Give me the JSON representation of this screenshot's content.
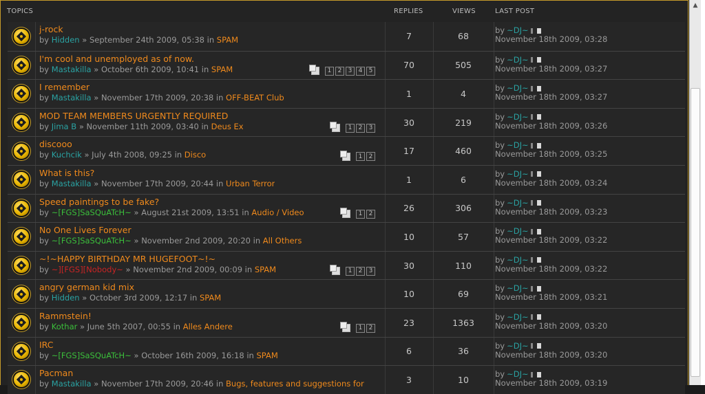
{
  "headers": {
    "topics": "TOPICS",
    "replies": "REPLIES",
    "views": "VIEWS",
    "last_post": "LAST POST"
  },
  "by_word": "by",
  "in_word": "in",
  "sep": "»",
  "topics": [
    {
      "title": "j-rock",
      "author": "Hidden",
      "author_color": "blue",
      "date": "September 24th 2009, 05:38",
      "forum": "SPAM",
      "pages": [],
      "replies": "7",
      "views": "68",
      "last_user": "~DJ~",
      "last_date": "November 18th 2009, 03:28"
    },
    {
      "title": "I'm cool and unemployed as of now.",
      "author": "Mastakilla",
      "author_color": "blue",
      "date": "October 6th 2009, 10:41",
      "forum": "SPAM",
      "pages": [
        "1",
        "2",
        "3",
        "4",
        "5"
      ],
      "replies": "70",
      "views": "505",
      "last_user": "~DJ~",
      "last_date": "November 18th 2009, 03:27"
    },
    {
      "title": "I remember",
      "author": "Mastakilla",
      "author_color": "blue",
      "date": "November 17th 2009, 20:38",
      "forum": "OFF-BEAT Club",
      "pages": [],
      "replies": "1",
      "views": "4",
      "last_user": "~DJ~",
      "last_date": "November 18th 2009, 03:27"
    },
    {
      "title": "MOD TEAM MEMBERS URGENTLY REQUIRED",
      "author": "Jima B",
      "author_color": "blue",
      "date": "November 11th 2009, 03:40",
      "forum": "Deus Ex",
      "pages": [
        "1",
        "2",
        "3"
      ],
      "replies": "30",
      "views": "219",
      "last_user": "~DJ~",
      "last_date": "November 18th 2009, 03:26"
    },
    {
      "title": "discooo",
      "author": "Kuchcik",
      "author_color": "blue",
      "date": "July 4th 2008, 09:25",
      "forum": "Disco",
      "pages": [
        "1",
        "2"
      ],
      "replies": "17",
      "views": "460",
      "last_user": "~DJ~",
      "last_date": "November 18th 2009, 03:25"
    },
    {
      "title": "What is this?",
      "author": "Mastakilla",
      "author_color": "blue",
      "date": "November 17th 2009, 20:44",
      "forum": "Urban Terror",
      "pages": [],
      "replies": "1",
      "views": "6",
      "last_user": "~DJ~",
      "last_date": "November 18th 2009, 03:24"
    },
    {
      "title": "Speed paintings to be fake?",
      "author": "~[FGS]SaSQuATcH~",
      "author_color": "green",
      "date": "August 21st 2009, 13:51",
      "forum": "Audio / Video",
      "pages": [
        "1",
        "2"
      ],
      "replies": "26",
      "views": "306",
      "last_user": "~DJ~",
      "last_date": "November 18th 2009, 03:23"
    },
    {
      "title": "No One Lives Forever",
      "author": "~[FGS]SaSQuATcH~",
      "author_color": "green",
      "date": "November 2nd 2009, 20:20",
      "forum": "All Others",
      "pages": [],
      "replies": "10",
      "views": "57",
      "last_user": "~DJ~",
      "last_date": "November 18th 2009, 03:22"
    },
    {
      "title": "~!~HAPPY BIRTHDAY MR HUGEFOOT~!~",
      "author": "~][FGS][Nobody~",
      "author_color": "red",
      "date": "November 2nd 2009, 00:09",
      "forum": "SPAM",
      "pages": [
        "1",
        "2",
        "3"
      ],
      "replies": "30",
      "views": "110",
      "last_user": "~DJ~",
      "last_date": "November 18th 2009, 03:22"
    },
    {
      "title": "angry german kid mix",
      "author": "Hidden",
      "author_color": "blue",
      "date": "October 3rd 2009, 12:17",
      "forum": "SPAM",
      "pages": [],
      "replies": "10",
      "views": "69",
      "last_user": "~DJ~",
      "last_date": "November 18th 2009, 03:21"
    },
    {
      "title": "Rammstein!",
      "author": "Kothar",
      "author_color": "green",
      "date": "June 5th 2007, 00:55",
      "forum": "Alles Andere",
      "pages": [
        "1",
        "2"
      ],
      "replies": "23",
      "views": "1363",
      "last_user": "~DJ~",
      "last_date": "November 18th 2009, 03:20"
    },
    {
      "title": "IRC",
      "author": "~[FGS]SaSQuATcH~",
      "author_color": "green",
      "date": "October 16th 2009, 16:18",
      "forum": "SPAM",
      "pages": [],
      "replies": "6",
      "views": "36",
      "last_user": "~DJ~",
      "last_date": "November 18th 2009, 03:20"
    },
    {
      "title": "Pacman",
      "author": "Mastakilla",
      "author_color": "blue",
      "date": "November 17th 2009, 20:46",
      "forum": "Bugs, features and suggestions for",
      "pages": [],
      "replies": "3",
      "views": "10",
      "last_user": "~DJ~",
      "last_date": "November 18th 2009, 03:19"
    }
  ]
}
